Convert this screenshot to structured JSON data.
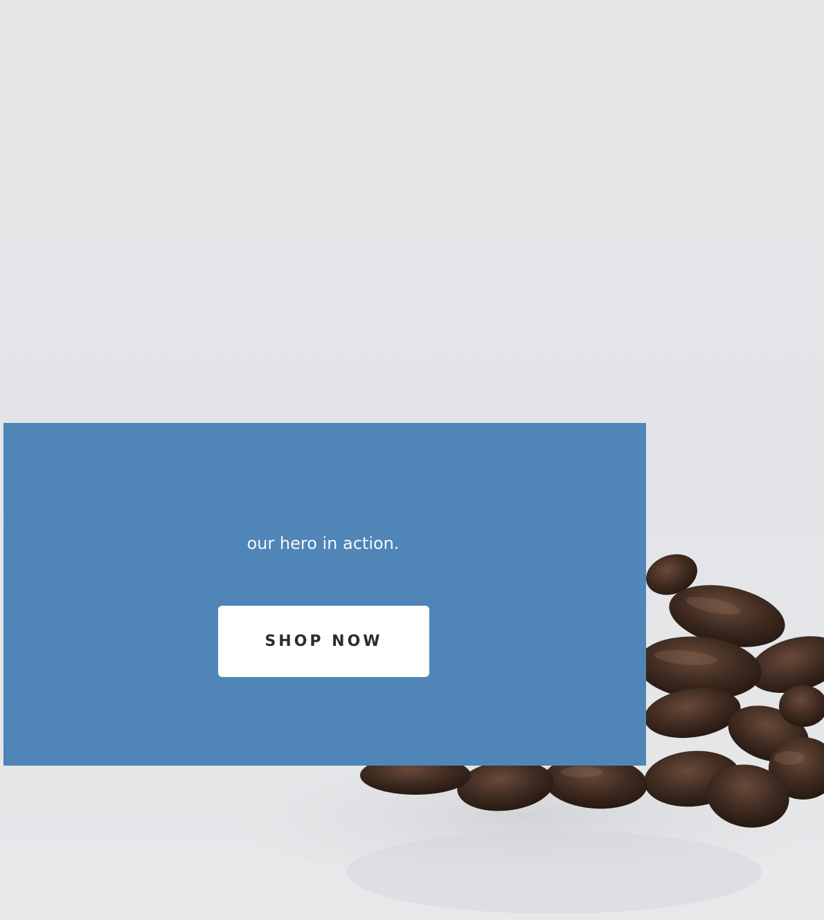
{
  "hero": {
    "image_icon": "coffee-beans-photo",
    "background_color": "#e4e5e7",
    "promo_color": "#4f85b7",
    "text": "our hero in action.",
    "button_label": "SHOP NOW"
  }
}
